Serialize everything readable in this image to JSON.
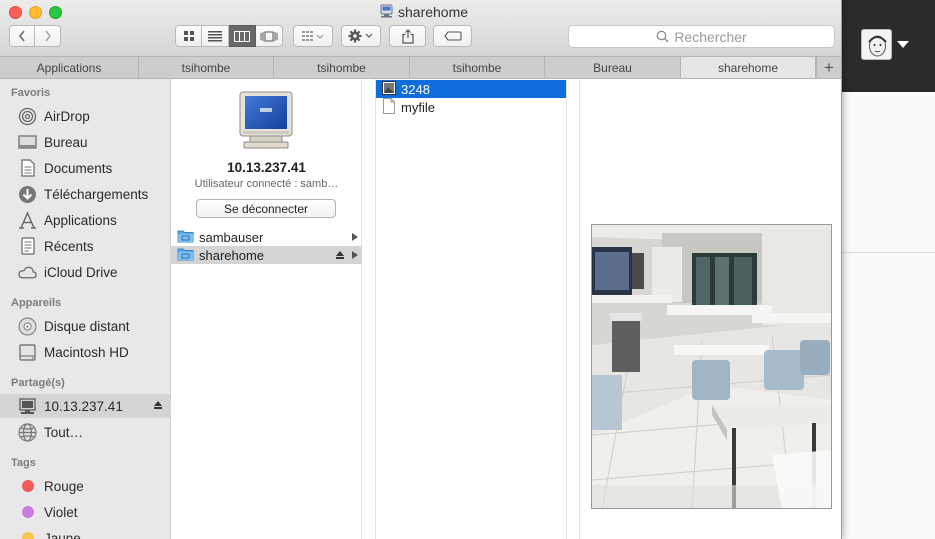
{
  "window": {
    "title": "sharehome"
  },
  "search": {
    "placeholder": "Rechercher"
  },
  "tabs": [
    {
      "label": "Applications",
      "active": false
    },
    {
      "label": "tsihombe",
      "active": false
    },
    {
      "label": "tsihombe",
      "active": false
    },
    {
      "label": "tsihombe",
      "active": false
    },
    {
      "label": "Bureau",
      "active": false
    },
    {
      "label": "sharehome",
      "active": true
    }
  ],
  "tab_add": "+",
  "sidebar": {
    "favorites_header": "Favoris",
    "favorites": [
      {
        "label": "AirDrop",
        "icon": "airdrop-icon"
      },
      {
        "label": "Bureau",
        "icon": "desktop-icon"
      },
      {
        "label": "Documents",
        "icon": "documents-icon"
      },
      {
        "label": "Téléchargements",
        "icon": "downloads-icon"
      },
      {
        "label": "Applications",
        "icon": "applications-icon"
      },
      {
        "label": "Récents",
        "icon": "recents-icon"
      },
      {
        "label": "iCloud Drive",
        "icon": "icloud-icon"
      }
    ],
    "devices_header": "Appareils",
    "devices": [
      {
        "label": "Disque distant",
        "icon": "disc-icon"
      },
      {
        "label": "Macintosh HD",
        "icon": "harddisk-icon"
      }
    ],
    "shared_header": "Partagé(s)",
    "shared": [
      {
        "label": "10.13.237.41",
        "icon": "server-icon",
        "selected": true
      },
      {
        "label": "Tout…",
        "icon": "network-icon"
      }
    ],
    "tags_header": "Tags",
    "tags": [
      {
        "label": "Rouge",
        "color": "#f45a57"
      },
      {
        "label": "Violet",
        "color": "#c77ae0"
      },
      {
        "label": "Jaune",
        "color": "#f9c74f"
      }
    ]
  },
  "server": {
    "name": "10.13.237.41",
    "status": "Utilisateur connecté : samb…",
    "disconnect_label": "Se déconnecter",
    "shares": [
      {
        "label": "sambauser"
      },
      {
        "label": "sharehome"
      }
    ]
  },
  "files": [
    {
      "label": "3248",
      "type": "image"
    },
    {
      "label": "myfile",
      "type": "document"
    }
  ],
  "colors": {
    "selection_blue": "#0f6ddb",
    "sidebar_bg": "#e9e7e9"
  }
}
